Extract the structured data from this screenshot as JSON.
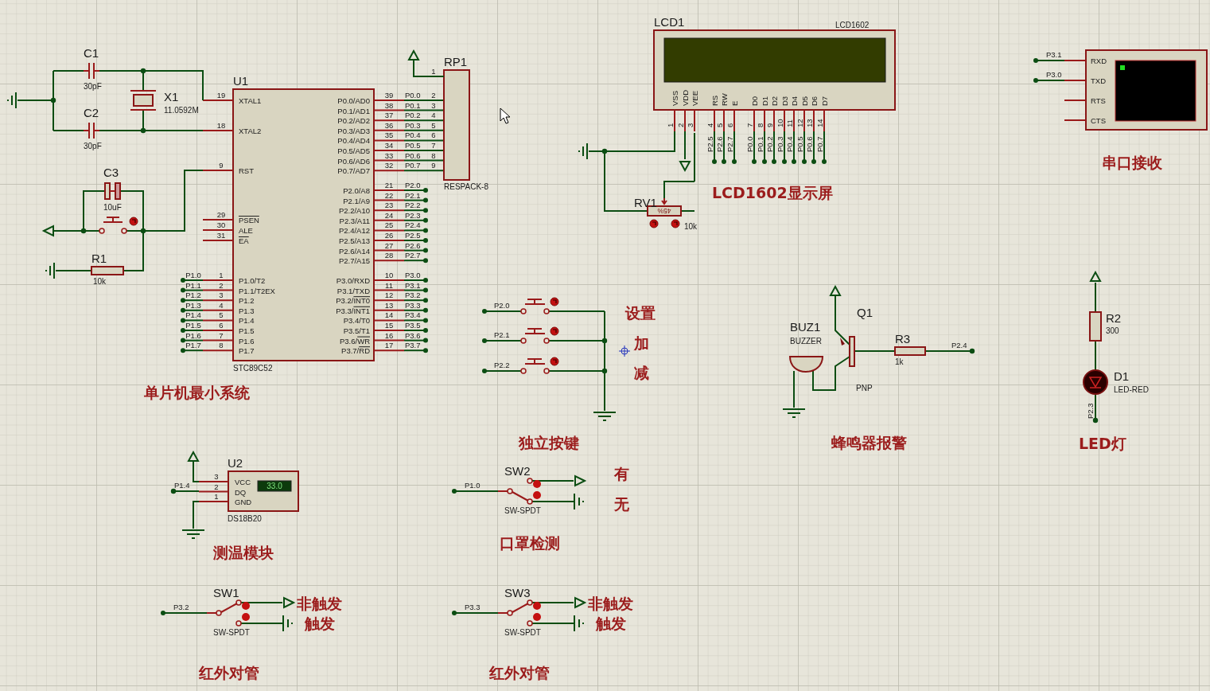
{
  "mcu": {
    "ref": "U1",
    "part": "STC89C52",
    "left_pins": [
      {
        "num": "19",
        "name": "XTAL1"
      },
      {
        "num": "18",
        "name": "XTAL2"
      },
      {
        "num": "9",
        "name": "RST"
      },
      {
        "num": "29",
        "bar": "PSEN"
      },
      {
        "num": "30",
        "name": "ALE"
      },
      {
        "num": "31",
        "bar": "EA"
      },
      {
        "num": "1",
        "name": "P1.0/T2",
        "net": "P1.0"
      },
      {
        "num": "2",
        "name": "P1.1/T2EX",
        "net": "P1.1"
      },
      {
        "num": "3",
        "name": "P1.2",
        "net": "P1.2"
      },
      {
        "num": "4",
        "name": "P1.3",
        "net": "P1.3"
      },
      {
        "num": "5",
        "name": "P1.4",
        "net": "P1.4"
      },
      {
        "num": "6",
        "name": "P1.5",
        "net": "P1.5"
      },
      {
        "num": "7",
        "name": "P1.6",
        "net": "P1.6"
      },
      {
        "num": "8",
        "name": "P1.7",
        "net": "P1.7"
      }
    ],
    "right_pins": [
      {
        "num": "39",
        "name": "P0.0/AD0",
        "net": "P0.0"
      },
      {
        "num": "38",
        "name": "P0.1/AD1",
        "net": "P0.1"
      },
      {
        "num": "37",
        "name": "P0.2/AD2",
        "net": "P0.2"
      },
      {
        "num": "36",
        "name": "P0.3/AD3",
        "net": "P0.3"
      },
      {
        "num": "35",
        "name": "P0.4/AD4",
        "net": "P0.4"
      },
      {
        "num": "34",
        "name": "P0.5/AD5",
        "net": "P0.5"
      },
      {
        "num": "33",
        "name": "P0.6/AD6",
        "net": "P0.6"
      },
      {
        "num": "32",
        "name": "P0.7/AD7",
        "net": "P0.7"
      },
      {
        "num": "21",
        "name": "P2.0/A8",
        "net": "P2.0"
      },
      {
        "num": "22",
        "name": "P2.1/A9",
        "net": "P2.1"
      },
      {
        "num": "23",
        "name": "P2.2/A10",
        "net": "P2.2"
      },
      {
        "num": "24",
        "name": "P2.3/A11",
        "net": "P2.3"
      },
      {
        "num": "25",
        "name": "P2.4/A12",
        "net": "P2.4"
      },
      {
        "num": "26",
        "name": "P2.5/A13",
        "net": "P2.5"
      },
      {
        "num": "27",
        "name": "P2.6/A14",
        "net": "P2.6"
      },
      {
        "num": "28",
        "name": "P2.7/A15",
        "net": "P2.7"
      },
      {
        "num": "10",
        "name": "P3.0/RXD",
        "net": "P3.0"
      },
      {
        "num": "11",
        "name": "P3.1/TXD",
        "net": "P3.1"
      },
      {
        "num": "12",
        "name": "P3.2/",
        "bar": "INT0",
        "net": "P3.2"
      },
      {
        "num": "13",
        "name": "P3.3/",
        "bar": "INT1",
        "net": "P3.3"
      },
      {
        "num": "14",
        "name": "P3.4/T0",
        "net": "P3.4"
      },
      {
        "num": "15",
        "name": "P3.5/T1",
        "net": "P3.5"
      },
      {
        "num": "16",
        "name": "P3.6/",
        "bar": "WR",
        "net": "P3.6"
      },
      {
        "num": "17",
        "name": "P3.7/",
        "bar": "RD",
        "net": "P3.7"
      }
    ]
  },
  "crystal": {
    "ref": "X1",
    "value": "11.0592M"
  },
  "capacitors": [
    {
      "ref": "C1",
      "value": "30pF"
    },
    {
      "ref": "C2",
      "value": "30pF"
    },
    {
      "ref": "C3",
      "value": "10uF"
    }
  ],
  "resistors": [
    {
      "ref": "R1",
      "value": "10k"
    },
    {
      "ref": "R2",
      "value": "300"
    },
    {
      "ref": "R3",
      "value": "1k"
    }
  ],
  "resistor_pack": {
    "ref": "RP1",
    "part": "RESPACK-8",
    "pins": [
      "1",
      "2",
      "3",
      "4",
      "5",
      "6",
      "7",
      "8",
      "9"
    ]
  },
  "lcd": {
    "ref": "LCD1",
    "part": "LCD1602",
    "pins": [
      {
        "name": "VSS",
        "num": "1"
      },
      {
        "name": "VDD",
        "num": "2"
      },
      {
        "name": "VEE",
        "num": "3"
      },
      {
        "name": "RS",
        "num": "4",
        "net": "P2.5"
      },
      {
        "name": "RW",
        "num": "5",
        "net": "P2.6"
      },
      {
        "name": "E",
        "num": "6",
        "net": "P2.7"
      },
      {
        "name": "D0",
        "num": "7",
        "net": "P0.0"
      },
      {
        "name": "D1",
        "num": "8",
        "net": "P0.1"
      },
      {
        "name": "D2",
        "num": "9",
        "net": "P0.2"
      },
      {
        "name": "D3",
        "num": "10",
        "net": "P0.3"
      },
      {
        "name": "D4",
        "num": "11",
        "net": "P0.4"
      },
      {
        "name": "D5",
        "num": "12",
        "net": "P0.5"
      },
      {
        "name": "D6",
        "num": "13",
        "net": "P0.6"
      },
      {
        "name": "D7",
        "num": "14",
        "net": "P0.7"
      }
    ]
  },
  "pot": {
    "ref": "RV1",
    "value": "10k",
    "reading": "45%"
  },
  "serial_terminal": {
    "pins": [
      {
        "name": "RXD",
        "net": "P3.1"
      },
      {
        "name": "TXD",
        "net": "P3.0"
      },
      {
        "name": "RTS"
      },
      {
        "name": "CTS"
      }
    ]
  },
  "push_buttons": [
    {
      "net": "P2.0"
    },
    {
      "net": "P2.1"
    },
    {
      "net": "P2.2"
    }
  ],
  "buzzer": {
    "ref": "BUZ1",
    "part": "BUZZER"
  },
  "transistor": {
    "ref": "Q1",
    "part": "PNP",
    "net": "P2.4"
  },
  "led": {
    "ref": "D1",
    "part": "LED-RED",
    "net": "P2.3"
  },
  "sensor": {
    "ref": "U2",
    "part": "DS18B20",
    "reading": "33.0",
    "net": "P1.4",
    "pins": [
      {
        "num": "3",
        "name": "VCC"
      },
      {
        "num": "2",
        "name": "DQ"
      },
      {
        "num": "1",
        "name": "GND"
      }
    ]
  },
  "switches": [
    {
      "ref": "SW2",
      "part": "SW-SPDT",
      "net": "P1.0",
      "to_upper": false
    },
    {
      "ref": "SW1",
      "part": "SW-SPDT",
      "net": "P3.2",
      "to_upper": true
    },
    {
      "ref": "SW3",
      "part": "SW-SPDT",
      "net": "P3.3",
      "to_upper": true
    }
  ],
  "notes": [
    "设置",
    "加",
    "减",
    "有",
    "无",
    "非触发",
    "触发",
    "非触发",
    "触发"
  ],
  "section_titles": [
    "单片机最小系统",
    "LCD1602显示屏",
    "串口接收",
    "独立按键",
    "蜂鸣器报警",
    "LED灯",
    "测温模块",
    "口罩检测",
    "红外对管",
    "红外对管"
  ]
}
